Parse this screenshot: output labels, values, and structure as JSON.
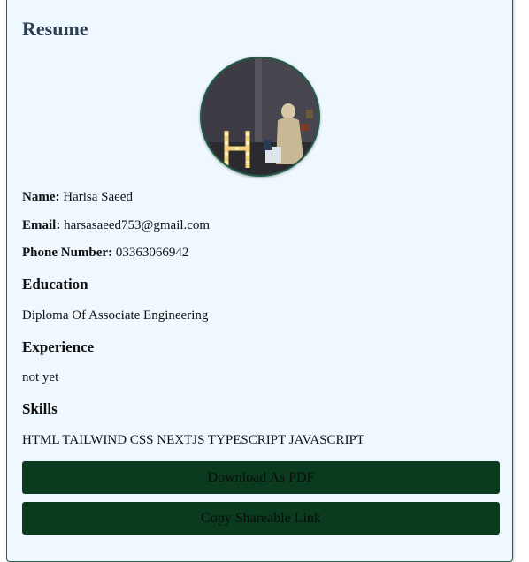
{
  "resume": {
    "title": "Resume",
    "name_label": "Name:",
    "name_value": "Harisa Saeed",
    "email_label": "Email:",
    "email_value": "harsasaeed753@gmail.com",
    "phone_label": "Phone Number:",
    "phone_value": "03363066942",
    "photo": "profile-photo"
  },
  "sections": {
    "education_heading": "Education",
    "education_text": "Diploma Of Associate Engineering",
    "experience_heading": "Experience",
    "experience_text": "not yet",
    "skills_heading": "Skills",
    "skills_text": "HTML TAILWIND CSS NEXTJS TYPESCRIPT JAVASCRIPT"
  },
  "actions": {
    "download_label": "Download As PDF",
    "copy_label": "Copy Shareable Link"
  },
  "colors": {
    "card_background": "#eef8fe",
    "button_background": "#0a3b1f",
    "title_color": "#2c3e50"
  }
}
